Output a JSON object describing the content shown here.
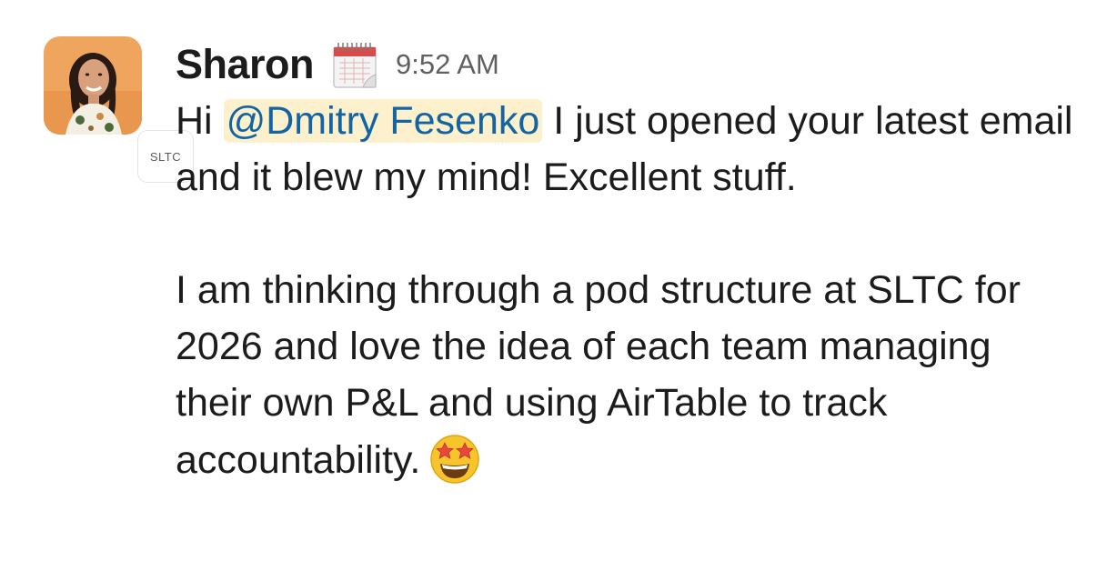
{
  "message": {
    "sender": "Sharon",
    "status_icon": "spiral-calendar-pad-icon",
    "timestamp": "9:52 AM",
    "org_badge": "SLTC",
    "paragraph1": {
      "prefix": "Hi ",
      "mention": "@Dmitry Fesenko",
      "suffix": " I just opened your latest email and it blew my mind! Excellent stuff."
    },
    "paragraph2": {
      "text": "I am thinking through a pod structure at SLTC for 2026 and love the idea of each team managing their own P&L and using AirTable to track accountability.",
      "emoji": "star-struck-emoji-icon"
    }
  },
  "colors": {
    "mention_text": "#1264a3",
    "mention_bg": "#fdf0cc",
    "timestamp": "#616061",
    "text": "#1d1c1d",
    "avatar_bg": "#f0a55f"
  }
}
